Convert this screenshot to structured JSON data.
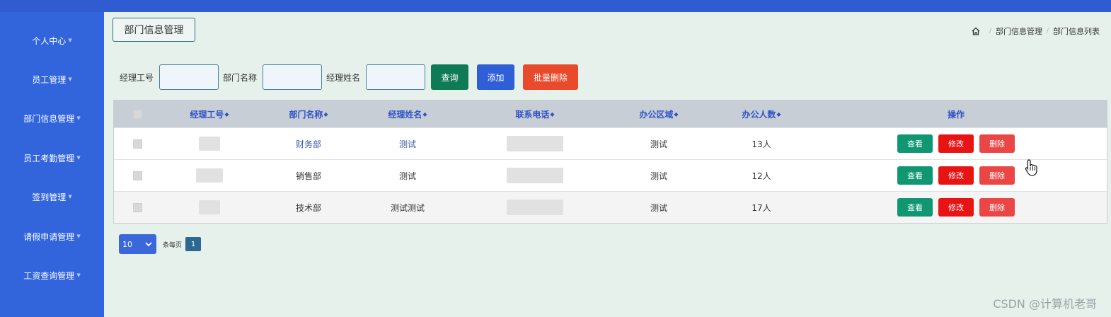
{
  "sidebar": {
    "items": [
      {
        "label": "个人中心"
      },
      {
        "label": "员工管理"
      },
      {
        "label": "部门信息管理"
      },
      {
        "label": "员工考勤管理"
      },
      {
        "label": "签到管理"
      },
      {
        "label": "请假申请管理"
      },
      {
        "label": "工资查询管理"
      }
    ]
  },
  "header": {
    "page_title": "部门信息管理",
    "breadcrumb": [
      "部门信息管理",
      "部门信息列表"
    ]
  },
  "search": {
    "fields": [
      {
        "label": "经理工号",
        "value": ""
      },
      {
        "label": "部门名称",
        "value": ""
      },
      {
        "label": "经理姓名",
        "value": ""
      }
    ],
    "query_label": "查询",
    "add_label": "添加",
    "batch_delete_label": "批量删除"
  },
  "table": {
    "columns": [
      "经理工号",
      "部门名称",
      "经理姓名",
      "联系电话",
      "办公区域",
      "办公人数",
      "操作"
    ],
    "rows": [
      {
        "department": "财务部",
        "manager": "测试",
        "area": "测试",
        "count": "13人"
      },
      {
        "department": "销售部",
        "manager": "测试",
        "area": "测试",
        "count": "12人"
      },
      {
        "department": "技术部",
        "manager": "测试测试",
        "area": "测试",
        "count": "17人"
      }
    ],
    "actions": {
      "view": "查看",
      "edit": "修改",
      "delete": "删除"
    }
  },
  "pagination": {
    "page_size": "10",
    "per_page_label": "条每页",
    "current_page": "1"
  },
  "watermark": "CSDN @计算机老哥",
  "colors": {
    "sidebar": "#3264dc",
    "query": "#0f7a56",
    "add": "#2f5fd6",
    "batch_delete": "#ea4a2c",
    "view": "#109672",
    "edit": "#e81414",
    "delete": "#eb4646"
  }
}
